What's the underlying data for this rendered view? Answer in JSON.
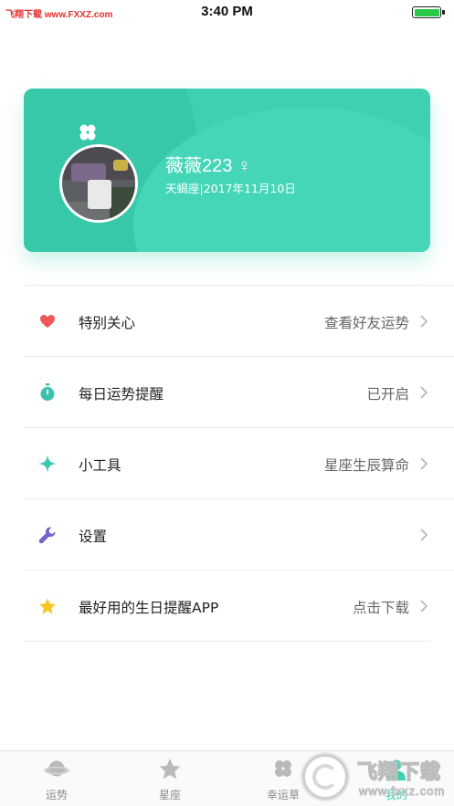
{
  "status_bar": {
    "watermark": "飞翔下载 www.FXXZ.com",
    "time": "3:40 PM"
  },
  "profile": {
    "name": "薇薇223 ♀",
    "sign_date": "天蝎座|2017年11月10日",
    "accent_color": "#3dd1b2"
  },
  "menu": {
    "items": [
      {
        "label": "特别关心",
        "value": "查看好友运势",
        "icon": "heart-icon",
        "color": "#f0575b"
      },
      {
        "label": "每日运势提醒",
        "value": "已开启",
        "icon": "stopwatch-icon",
        "color": "#3dbfae"
      },
      {
        "label": "小工具",
        "value": "星座生辰算命",
        "icon": "sparkle-icon",
        "color": "#3dc7b0"
      },
      {
        "label": "设置",
        "value": "",
        "icon": "wrench-icon",
        "color": "#6d65c9"
      },
      {
        "label": "最好用的生日提醒APP",
        "value": "点击下载",
        "icon": "star-icon",
        "color": "#f5c623"
      }
    ]
  },
  "tabs": [
    {
      "label": "运势",
      "icon": "planet-icon"
    },
    {
      "label": "星座",
      "icon": "star-icon"
    },
    {
      "label": "幸运草",
      "icon": "clover-icon"
    },
    {
      "label": "我的",
      "icon": "user-icon"
    }
  ],
  "watermark_bottom": {
    "title": "飞翔下载",
    "url": "www.fxxz.com"
  }
}
